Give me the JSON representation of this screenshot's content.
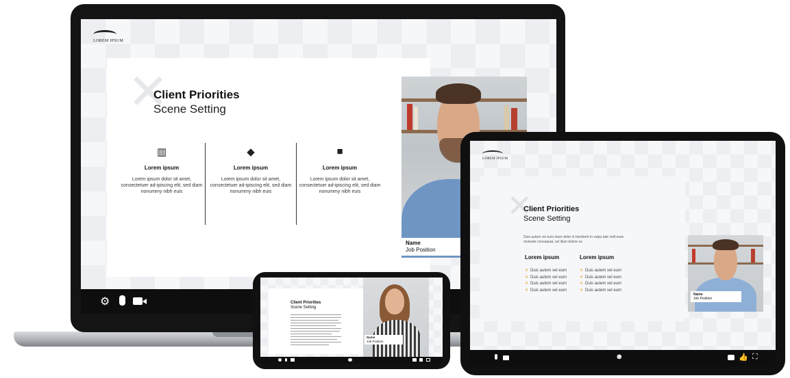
{
  "laptop": {
    "logo_text": "LOREM IPSUM",
    "title": "Client Priorities",
    "subtitle": "Scene Setting",
    "columns": [
      {
        "icon": "building-icon",
        "heading": "Lorem ipsum",
        "body": "Lorem ipsum dolor sit amet, consectetuer ad-ipiscing elit, sed diam nonummy nibh euis"
      },
      {
        "icon": "diamond-arrow-icon",
        "heading": "Lorem ipsum",
        "body": "Lorem ipsum dolor sit amet, consectetuer ad-ipiscing elit, sed diam nonummy nibh euis"
      },
      {
        "icon": "camera-icon",
        "heading": "Lorem ipsum",
        "body": "Lorem ipsum dolor sit amet, consectetuer ad-ipiscing elit, sed diam nonummy nibh euis"
      }
    ],
    "video": {
      "name": "Name",
      "position": "Job Position"
    },
    "toolbar": [
      "gear-icon",
      "microphone-icon",
      "video-camera-icon"
    ]
  },
  "tablet": {
    "logo_text": "LOREM IPSUM",
    "title": "Client Priorities",
    "subtitle": "Scene Setting",
    "intro": "Duis autem vel eum iriure dolor in hendrerit in vulpu tate velit esse molestie consequat, vel illum dolore eu",
    "lists": [
      {
        "heading": "Lorem ipsum",
        "items": [
          "Duis autem vel eum",
          "Duis autem vel eum",
          "Duis autem vel eum",
          "Duis autem vel eum"
        ]
      },
      {
        "heading": "Lorem ipsum",
        "items": [
          "Duis autem vel eum",
          "Duis autem vel eum",
          "Duis autem vel eum",
          "Duis autem vel eum"
        ]
      }
    ],
    "video": {
      "name": "Name",
      "position": "Job Position"
    },
    "toolbar": [
      "microphone-icon",
      "video-camera-icon",
      "people-icon",
      "chat-icon",
      "thumbs-up-icon",
      "fullscreen-icon"
    ]
  },
  "phone": {
    "title": "Client Priorities",
    "subtitle": "Scene Setting",
    "video": {
      "name": "Name",
      "position": "Job Position"
    }
  },
  "colors": {
    "accent": "#e8a020",
    "toolbar": "#0e0e0e",
    "frame": "#141414"
  }
}
